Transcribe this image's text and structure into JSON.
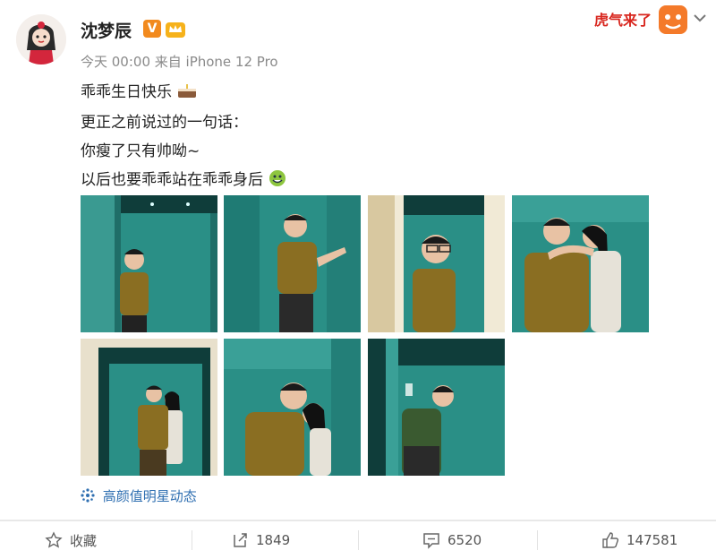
{
  "post": {
    "username": "沈梦辰",
    "verified_mark": "V",
    "meta": "今天 00:00 来自 iPhone 12 Pro",
    "lines": [
      "乖乖生日快乐",
      "更正之前说过的一句话：",
      "你瘦了只有帅呦~",
      "以后也要乖乖站在乖乖身后"
    ],
    "sticker_text": "虎气来了",
    "topic_tag": "高颜值明星动态"
  },
  "actions": {
    "favorite_label": "收藏",
    "repost_count": "1849",
    "comment_count": "6520",
    "like_count": "147581"
  },
  "icons": [
    "cake-emoji-icon",
    "grinning-emoji-icon",
    "crown-badge-icon",
    "chevron-down-icon",
    "star-icon",
    "repost-icon",
    "comment-icon",
    "thumbs-up-icon",
    "topic-sparkle-icon"
  ],
  "colors": {
    "link": "#2f6fb1",
    "verified": "#f28a1e",
    "elevator_teal": "#2a8f86",
    "shirt": "#8a6e22"
  }
}
